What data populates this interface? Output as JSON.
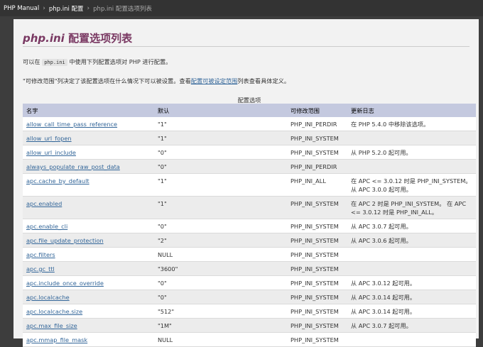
{
  "breadcrumb": {
    "root": "PHP Manual",
    "parent": "php.ini 配置",
    "current": "php.ini 配置选项列表"
  },
  "title": "配置选项列表",
  "title_prefix": "php.ini",
  "intro": {
    "before": "可以在",
    "code": "php.ini",
    "after": "中使用下列配置选项对 PHP 进行配置。"
  },
  "note": {
    "before": "\"可修改范围\"列决定了该配置选项在什么情况下可以被设置。查看",
    "link": "配置可被设定范围",
    "after": "列表查看具体定义。"
  },
  "table": {
    "caption": "配置选项",
    "headers": [
      "名字",
      "默认",
      "可修改范围",
      "更新日志"
    ],
    "rows": [
      [
        "allow_call_time_pass_reference",
        "\"1\"",
        "PHP_INI_PERDIR",
        "在 PHP 5.4.0 中移除该选项。"
      ],
      [
        "allow_url_fopen",
        "\"1\"",
        "PHP_INI_SYSTEM",
        ""
      ],
      [
        "allow_url_include",
        "\"0\"",
        "PHP_INI_SYSTEM",
        "从 PHP 5.2.0 起可用。"
      ],
      [
        "always_populate_raw_post_data",
        "\"0\"",
        "PHP_INI_PERDIR",
        ""
      ],
      [
        "apc.cache_by_default",
        "\"1\"",
        "PHP_INI_ALL",
        "在 APC <= 3.0.12 时是 PHP_INI_SYSTEM。 从 APC 3.0.0 起可用。"
      ],
      [
        "apc.enabled",
        "\"1\"",
        "PHP_INI_SYSTEM",
        "在 APC 2 时是 PHP_INI_SYSTEM。 在 APC <= 3.0.12 时是 PHP_INI_ALL。"
      ],
      [
        "apc.enable_cli",
        "\"0\"",
        "PHP_INI_SYSTEM",
        "从 APC 3.0.7 起可用。"
      ],
      [
        "apc.file_update_protection",
        "\"2\"",
        "PHP_INI_SYSTEM",
        "从 APC 3.0.6 起可用。"
      ],
      [
        "apc.filters",
        "NULL",
        "PHP_INI_SYSTEM",
        ""
      ],
      [
        "apc.gc_ttl",
        "\"3600\"",
        "PHP_INI_SYSTEM",
        ""
      ],
      [
        "apc.include_once_override",
        "\"0\"",
        "PHP_INI_SYSTEM",
        "从 APC 3.0.12 起可用。"
      ],
      [
        "apc.localcache",
        "\"0\"",
        "PHP_INI_SYSTEM",
        "从 APC 3.0.14 起可用。"
      ],
      [
        "apc.localcache.size",
        "\"512\"",
        "PHP_INI_SYSTEM",
        "从 APC 3.0.14 起可用。"
      ],
      [
        "apc.max_file_size",
        "\"1M\"",
        "PHP_INI_SYSTEM",
        "从 APC 3.0.7 起可用。"
      ],
      [
        "apc.mmap_file_mask",
        "NULL",
        "PHP_INI_SYSTEM",
        ""
      ]
    ]
  }
}
